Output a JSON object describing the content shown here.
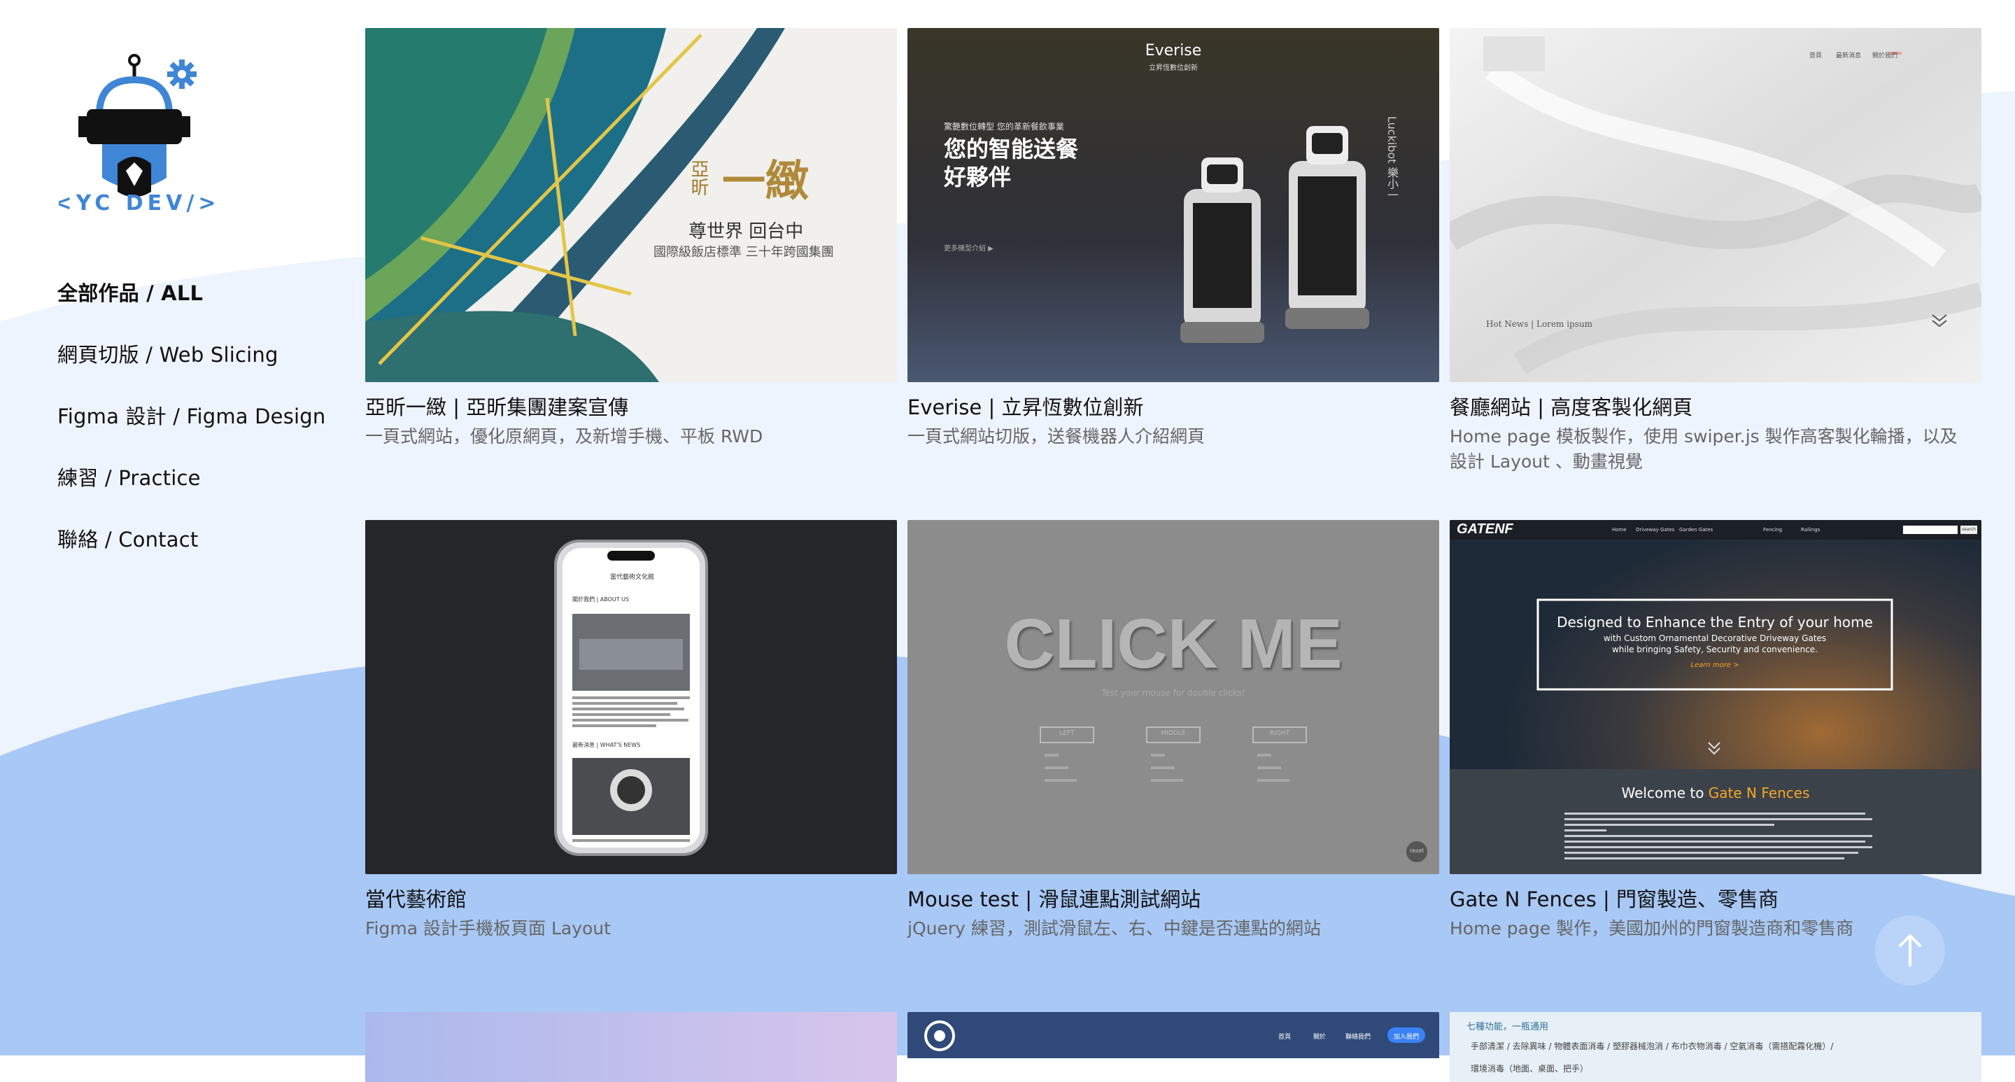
{
  "brand": {
    "logo_text": "<YC DEV/>"
  },
  "nav": {
    "items": [
      {
        "label": "全部作品 / ALL",
        "active": true
      },
      {
        "label": "網頁切版 / Web Slicing",
        "active": false
      },
      {
        "label": "Figma 設計 / Figma Design",
        "active": false
      },
      {
        "label": "練習 / Practice",
        "active": false
      },
      {
        "label": "聯絡 / Contact",
        "active": false
      }
    ]
  },
  "projects": [
    {
      "title": "亞昕一緻 | 亞昕集團建案宣傳",
      "desc": "一頁式網站，優化原網頁，及新增手機、平板 RWD",
      "thumb": {
        "logo": "亞昕",
        "headline": "一緻",
        "sub1": "尊世界 回台中",
        "sub2": "國際級飯店標準 三十年跨國集團"
      }
    },
    {
      "title": "Everise | 立昇恆數位創新",
      "desc": "一頁式網站切版，送餐機器人介紹網頁",
      "thumb": {
        "brand": "Everise",
        "brand_sub": "立昇恆數位創新",
        "kicker": "驚艷數位轉型 您的革新餐飲事業",
        "headline1": "您的智能送餐",
        "headline2": "好夥伴",
        "cta": "更多機型介紹 ▶",
        "robot": "Luckibot 樂小一"
      }
    },
    {
      "title": "餐廳網站 | 高度客製化網頁",
      "desc": "Home page 模板製作，使用 swiper.js 製作高客製化輪播，以及設計 Layout 、動畫視覺",
      "thumb": {
        "nav1": "首頁",
        "nav2": "最新消息",
        "nav3": "關於我們",
        "news": "Hot News | Lorem ipsum"
      }
    },
    {
      "title": "當代藝術館",
      "desc": "Figma 設計手機板頁面 Layout",
      "thumb": {
        "app": "當代藝術文化館",
        "about": "關於我們 | ABOUT US",
        "news": "最新消息 | WHAT'S NEWS"
      }
    },
    {
      "title": "Mouse test | 滑鼠連點測試網站",
      "desc": "jQuery 練習，測試滑鼠左、右、中鍵是否連點的網站",
      "thumb": {
        "headline": "CLICK ME",
        "sub": "Test your mouse for double clicks!",
        "left": "LEFT",
        "middle": "MIDDLE",
        "right": "RIGHT",
        "reset": "reset"
      }
    },
    {
      "title": "Gate N Fences | 門窗製造、零售商",
      "desc": "Home page 製作，美國加州的門窗製造商和零售商",
      "thumb": {
        "brand": "GATENF",
        "nav1": "Home",
        "nav2": "Driveway Gates",
        "nav3": "Garden Gates",
        "nav4": "Fencing",
        "nav5": "Railings",
        "search": "search",
        "hero1": "Designed to Enhance the Entry of your home",
        "hero2": "with Custom Ornamental Decorative Driveway Gates",
        "hero3": "while bringing Safety, Security and convenience.",
        "hero_cta": "Learn more >",
        "welcome": "Welcome to ",
        "welcome_brand": "Gate N Fences"
      }
    },
    {
      "title": "",
      "desc": "",
      "thumb": {}
    },
    {
      "title": "",
      "desc": "",
      "thumb": {
        "nav1": "首頁",
        "nav2": "關於",
        "nav3": "聯絡我們",
        "cta": "加入我們"
      }
    },
    {
      "title": "",
      "desc": "",
      "thumb": {
        "line1": "七種功能，一瓶通用",
        "line2": "手部清潔 / 去除異味 / 物體表面消毒 / 塑膠器械泡消 / 布巾衣物消毒 / 空氣消毒（需搭配霧化機）/",
        "line3": "環境消毒（地面、桌面、把手）"
      }
    }
  ],
  "colors": {
    "wave_light": "#eef4fd",
    "wave_blue": "#a8c8f5",
    "text_muted": "#666666",
    "accent_blue": "#3f86d6",
    "accent_yellow": "#f5a623"
  },
  "icons": {
    "back_to_top": "arrow-up-icon"
  }
}
